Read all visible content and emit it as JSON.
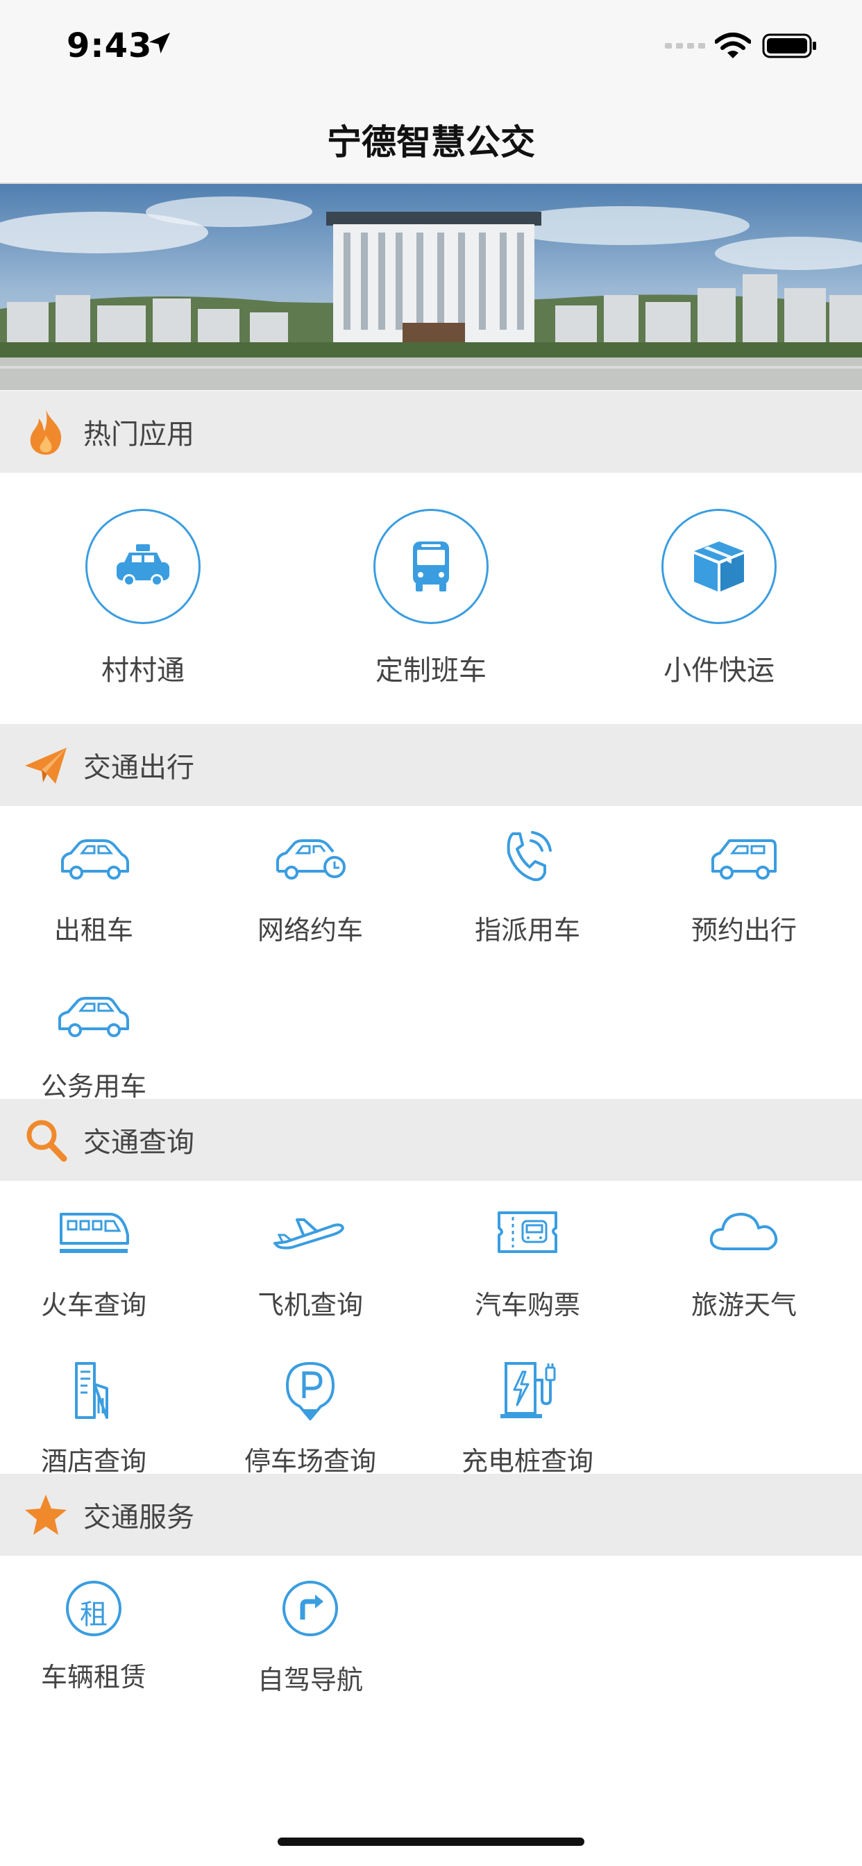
{
  "status": {
    "time": "9:43"
  },
  "nav": {
    "title": "宁德智慧公交"
  },
  "sections": {
    "hot": {
      "title": "热门应用",
      "items": [
        {
          "label": "村村通",
          "icon": "taxi-icon"
        },
        {
          "label": "定制班车",
          "icon": "bus-icon"
        },
        {
          "label": "小件快运",
          "icon": "package-icon"
        }
      ]
    },
    "travel": {
      "title": "交通出行",
      "items": [
        {
          "label": "出租车",
          "icon": "car-icon"
        },
        {
          "label": "网络约车",
          "icon": "car-clock-icon"
        },
        {
          "label": "指派用车",
          "icon": "phone-icon"
        },
        {
          "label": "预约出行",
          "icon": "van-icon"
        },
        {
          "label": "公务用车",
          "icon": "car-icon"
        }
      ]
    },
    "query": {
      "title": "交通查询",
      "items": [
        {
          "label": "火车查询",
          "icon": "train-icon"
        },
        {
          "label": "飞机查询",
          "icon": "airplane-icon"
        },
        {
          "label": "汽车购票",
          "icon": "ticket-icon"
        },
        {
          "label": "旅游天气",
          "icon": "cloud-icon"
        },
        {
          "label": "酒店查询",
          "icon": "hotel-icon"
        },
        {
          "label": "停车场查询",
          "icon": "parking-icon"
        },
        {
          "label": "充电桩查询",
          "icon": "charging-station-icon"
        }
      ]
    },
    "service": {
      "title": "交通服务",
      "items": [
        {
          "label": "车辆租赁",
          "icon": "rent-icon",
          "glyph": "租"
        },
        {
          "label": "自驾导航",
          "icon": "navigation-icon"
        }
      ]
    }
  },
  "colors": {
    "accent": "#3a9de0",
    "header_icon": "#f0892c",
    "section_bg": "#ebebeb"
  }
}
